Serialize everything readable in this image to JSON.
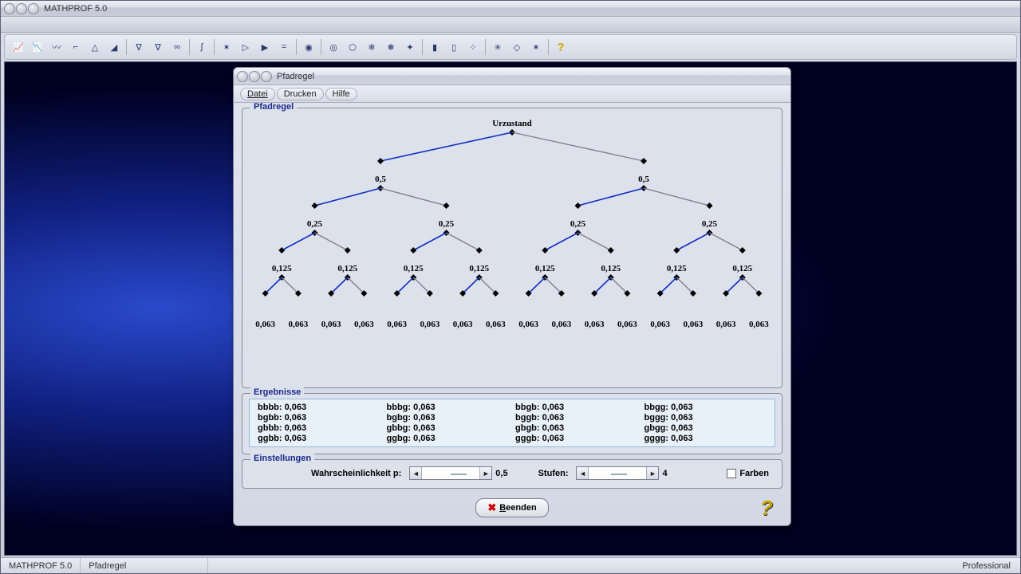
{
  "app": {
    "title": "MATHPROF 5.0"
  },
  "statusbar": {
    "left": "MATHPROF 5.0",
    "module": "Pfadregel",
    "edition": "Professional"
  },
  "child": {
    "title": "Pfadregel",
    "menu": {
      "file": "Datei",
      "print": "Drucken",
      "help": "Hilfe"
    },
    "group_tree": "Pfadregel",
    "group_results": "Ergebnisse",
    "group_settings": "Einstellungen",
    "root_label": "Urzustand",
    "settings": {
      "prob_label": "Wahrscheinlichkeit p:",
      "prob_value": "0,5",
      "steps_label": "Stufen:",
      "steps_value": "4",
      "colors_label": "Farben"
    },
    "close_btn": "Beenden"
  },
  "chart_data": {
    "type": "tree",
    "title": "Pfadregel",
    "root": "Urzustand",
    "p": 0.5,
    "levels": 4,
    "level_values": {
      "1": [
        0.5,
        0.5
      ],
      "2": [
        0.25,
        0.25,
        0.25,
        0.25
      ],
      "3": [
        0.125,
        0.125,
        0.125,
        0.125,
        0.125,
        0.125,
        0.125,
        0.125
      ],
      "4": [
        0.063,
        0.063,
        0.063,
        0.063,
        0.063,
        0.063,
        0.063,
        0.063,
        0.063,
        0.063,
        0.063,
        0.063,
        0.063,
        0.063,
        0.063,
        0.063
      ]
    },
    "results": [
      {
        "path": "bbbb",
        "p": 0.063
      },
      {
        "path": "bbbg",
        "p": 0.063
      },
      {
        "path": "bbgb",
        "p": 0.063
      },
      {
        "path": "bbgg",
        "p": 0.063
      },
      {
        "path": "bgbb",
        "p": 0.063
      },
      {
        "path": "bgbg",
        "p": 0.063
      },
      {
        "path": "bggb",
        "p": 0.063
      },
      {
        "path": "bggg",
        "p": 0.063
      },
      {
        "path": "gbbb",
        "p": 0.063
      },
      {
        "path": "gbbg",
        "p": 0.063
      },
      {
        "path": "gbgb",
        "p": 0.063
      },
      {
        "path": "gbgg",
        "p": 0.063
      },
      {
        "path": "ggbb",
        "p": 0.063
      },
      {
        "path": "ggbg",
        "p": 0.063
      },
      {
        "path": "gggb",
        "p": 0.063
      },
      {
        "path": "gggg",
        "p": 0.063
      }
    ]
  },
  "toolbar_icons": [
    "chart-line",
    "chart-line2",
    "chart-line3",
    "chart-axes",
    "chart-up",
    "chart-area",
    "nabla",
    "nabla2",
    "infinity",
    "integral",
    "asterisk",
    "cursor-play",
    "play",
    "equals",
    "disk-dark",
    "disk-lines",
    "shape",
    "snow1",
    "snow2",
    "spark",
    "bars1",
    "bars2",
    "scatter",
    "star1",
    "diamond",
    "star2",
    "help"
  ]
}
